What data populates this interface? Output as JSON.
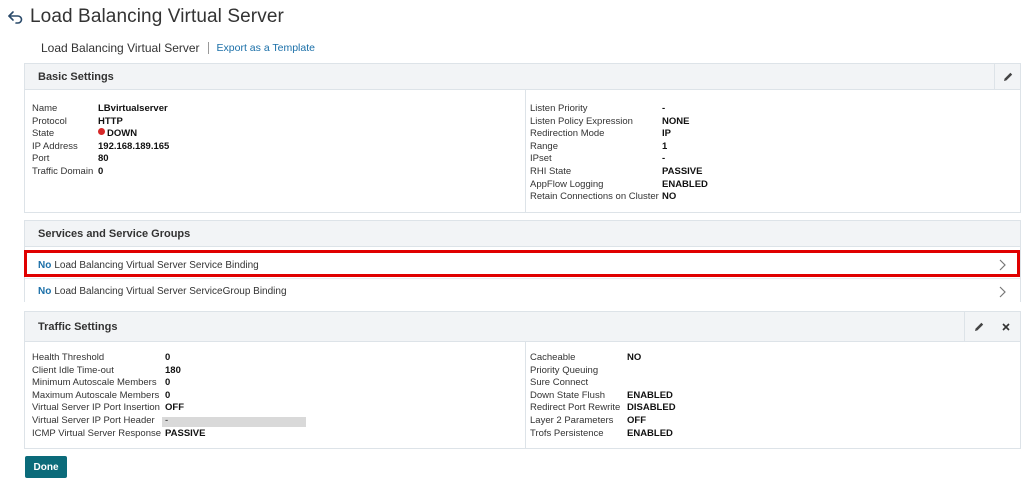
{
  "header": {
    "title": "Load Balancing Virtual Server"
  },
  "subheader": {
    "title": "Load Balancing Virtual Server",
    "export_link": "Export as a Template"
  },
  "basic": {
    "title": "Basic Settings",
    "left": [
      {
        "label": "Name",
        "value": "LBvirtualserver"
      },
      {
        "label": "Protocol",
        "value": "HTTP"
      },
      {
        "label": "State",
        "value": "DOWN"
      },
      {
        "label": "IP Address",
        "value": "192.168.189.165"
      },
      {
        "label": "Port",
        "value": "80"
      },
      {
        "label": "Traffic Domain",
        "value": "0"
      }
    ],
    "right": [
      {
        "label": "Listen Priority",
        "value": "-"
      },
      {
        "label": "Listen Policy Expression",
        "value": "NONE"
      },
      {
        "label": "Redirection Mode",
        "value": "IP"
      },
      {
        "label": "Range",
        "value": "1"
      },
      {
        "label": "IPset",
        "value": "-"
      },
      {
        "label": "RHI State",
        "value": "PASSIVE"
      },
      {
        "label": "AppFlow Logging",
        "value": "ENABLED"
      },
      {
        "label": "Retain Connections on Cluster",
        "value": "NO"
      }
    ]
  },
  "services": {
    "title": "Services and Service Groups",
    "rows": [
      {
        "prefix": "No",
        "label": "Load Balancing Virtual Server Service Binding"
      },
      {
        "prefix": "No",
        "label": "Load Balancing Virtual Server ServiceGroup Binding"
      }
    ]
  },
  "traffic": {
    "title": "Traffic Settings",
    "left": [
      {
        "label": "Health Threshold",
        "value": "0"
      },
      {
        "label": "Client Idle Time-out",
        "value": "180"
      },
      {
        "label": "Minimum Autoscale Members",
        "value": "0"
      },
      {
        "label": "Maximum Autoscale Members",
        "value": "0"
      },
      {
        "label": "Virtual Server IP Port Insertion",
        "value": "OFF"
      },
      {
        "label": "Virtual Server IP Port Header",
        "value": "-"
      },
      {
        "label": "ICMP Virtual Server Response",
        "value": "PASSIVE"
      }
    ],
    "right": [
      {
        "label": "Cacheable",
        "value": "NO"
      },
      {
        "label": "Priority Queuing",
        "value": ""
      },
      {
        "label": "Sure Connect",
        "value": ""
      },
      {
        "label": "Down State Flush",
        "value": "ENABLED"
      },
      {
        "label": "Redirect Port Rewrite",
        "value": "DISABLED"
      },
      {
        "label": "Layer 2 Parameters",
        "value": "OFF"
      },
      {
        "label": "Trofs Persistence",
        "value": "ENABLED"
      }
    ]
  },
  "footer": {
    "done_label": "Done"
  },
  "colors": {
    "accent": "#0b6b7a",
    "link": "#1a6fa8",
    "highlight": "#e00000",
    "down": "#d62828"
  },
  "icons": {
    "back": "back-arrow-icon",
    "edit": "pencil-icon",
    "close": "close-icon",
    "chevron": "chevron-right-icon"
  }
}
